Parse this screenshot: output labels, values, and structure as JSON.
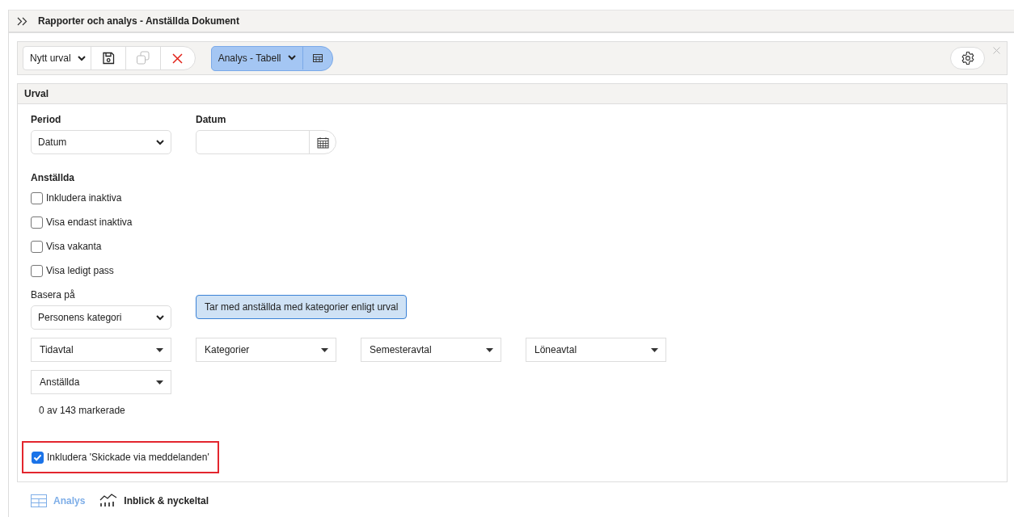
{
  "header": {
    "title": "Rapporter och analys - Anställda Dokument"
  },
  "toolbar": {
    "selection": "Nytt urval",
    "view": "Analys - Tabell"
  },
  "urval": {
    "title": "Urval",
    "period": {
      "label": "Period",
      "value": "Datum"
    },
    "date": {
      "label": "Datum"
    },
    "employees": {
      "label": "Anställda",
      "options": [
        {
          "label": "Inkludera inaktiva",
          "checked": false
        },
        {
          "label": "Visa endast inaktiva",
          "checked": false
        },
        {
          "label": "Visa vakanta",
          "checked": false
        },
        {
          "label": "Visa ledigt pass",
          "checked": false
        }
      ]
    },
    "base": {
      "label": "Basera på",
      "value": "Personens kategori",
      "info": "Tar med anställda med kategorier enligt urval"
    },
    "filters": [
      {
        "label": "Tidavtal"
      },
      {
        "label": "Kategorier"
      },
      {
        "label": "Semesteravtal"
      },
      {
        "label": "Löneavtal"
      },
      {
        "label": "Anställda"
      }
    ],
    "selected_count": "0 av 143 markerade",
    "include_messages": {
      "label": "Inkludera 'Skickade via meddelanden'",
      "checked": true,
      "highlighted": true
    }
  },
  "tabs": [
    {
      "label": "Analys",
      "selected": true
    },
    {
      "label": "Inblick & nyckeltal",
      "selected": false
    }
  ]
}
